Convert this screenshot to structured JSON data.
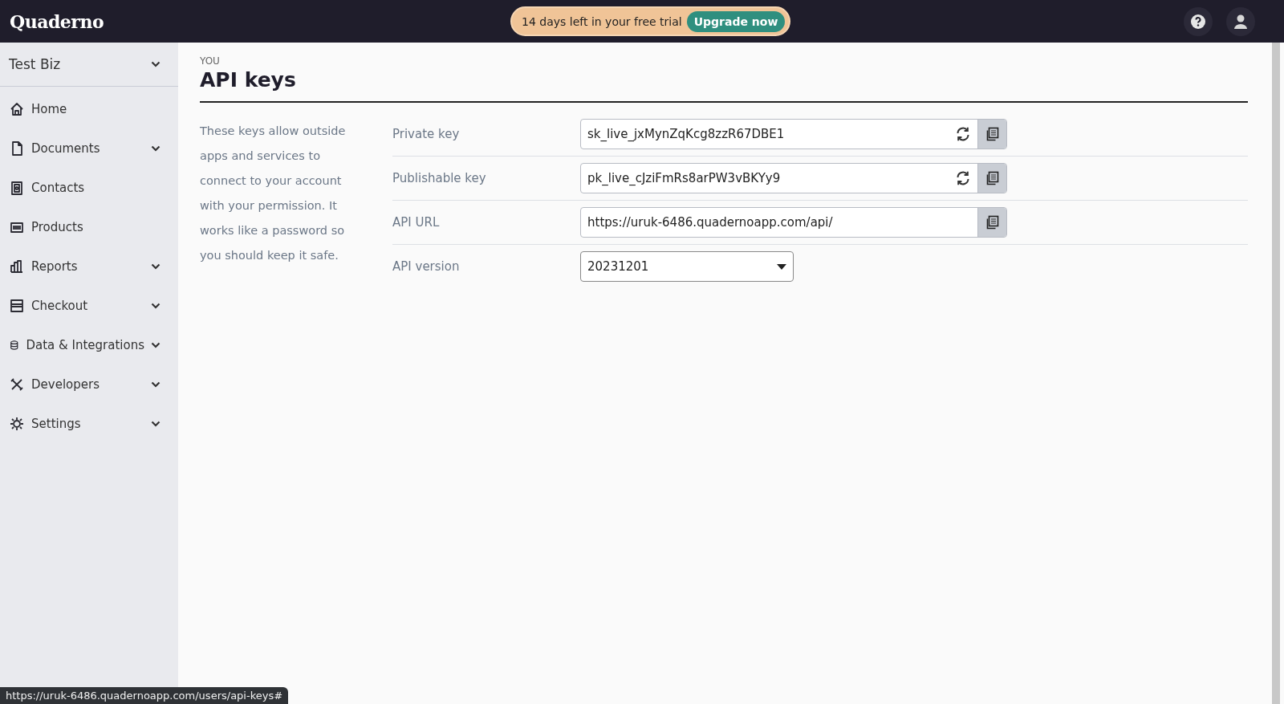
{
  "topbar": {
    "logo": "Quaderno",
    "trial_text": "14 days left in your free trial",
    "upgrade_button": "Upgrade now"
  },
  "sidebar": {
    "account": "Test Biz",
    "items": [
      {
        "label": "Home",
        "expandable": false
      },
      {
        "label": "Documents",
        "expandable": true
      },
      {
        "label": "Contacts",
        "expandable": false
      },
      {
        "label": "Products",
        "expandable": false
      },
      {
        "label": "Reports",
        "expandable": true
      },
      {
        "label": "Checkout",
        "expandable": true
      },
      {
        "label": "Data & Integrations",
        "expandable": true
      },
      {
        "label": "Developers",
        "expandable": true
      },
      {
        "label": "Settings",
        "expandable": true
      }
    ]
  },
  "page": {
    "eyebrow": "YOU",
    "title": "API keys",
    "description": "These keys allow outside apps and services to connect to your account with your permission. It works like a password so you should keep it safe.",
    "fields": [
      {
        "kind": "input",
        "label": "Private key",
        "value": "sk_live_jxMynZqKcg8zzR67DBE1",
        "regenerate": true
      },
      {
        "kind": "input",
        "label": "Publishable key",
        "value": "pk_live_cJziFmRs8arPW3vBKYy9",
        "regenerate": true
      },
      {
        "kind": "input",
        "label": "API URL",
        "value": "https://uruk-6486.quadernoapp.com/api/",
        "regenerate": false
      },
      {
        "kind": "select",
        "label": "API version",
        "value": "20231201"
      }
    ]
  },
  "status_bar": {
    "url": "https://uruk-6486.quadernoapp.com/users/api-keys#"
  }
}
